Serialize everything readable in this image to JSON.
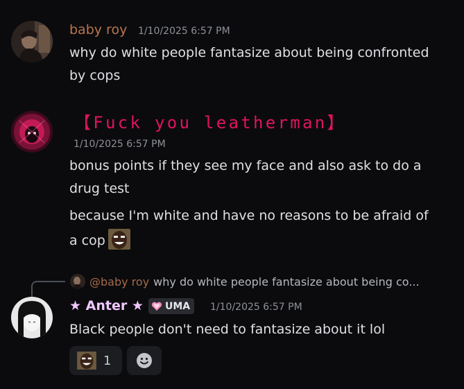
{
  "messages": [
    {
      "author": "baby roy",
      "author_color": "#b9754e",
      "timestamp": "1/10/2025 6:57 PM",
      "lines": [
        "why do white people fantasize about being confronted",
        "by cops"
      ]
    },
    {
      "author": "【Fuck you leatherman】",
      "author_color": "#e0145e",
      "timestamp": "1/10/2025 6:57 PM",
      "lines": [
        "bonus points if they see my face and also ask to do a",
        "drug test",
        "because I'm white and have no reasons to be afraid of",
        "a cop"
      ],
      "inline_emoji": "smiling-face-emoji"
    },
    {
      "reply": {
        "author": "@baby roy",
        "text": "why do white people fantasize about being co..."
      },
      "author": "★ Anter ★",
      "author_color": "#f0c8ff",
      "badge": "UMA",
      "timestamp": "1/10/2025 6:57 PM",
      "lines": [
        "Black people don't need to fantasize about it lol"
      ],
      "reactions": [
        {
          "emoji": "smiling-face-emoji",
          "count": "1"
        }
      ],
      "add_reaction_icon": "add-reaction-icon"
    }
  ]
}
